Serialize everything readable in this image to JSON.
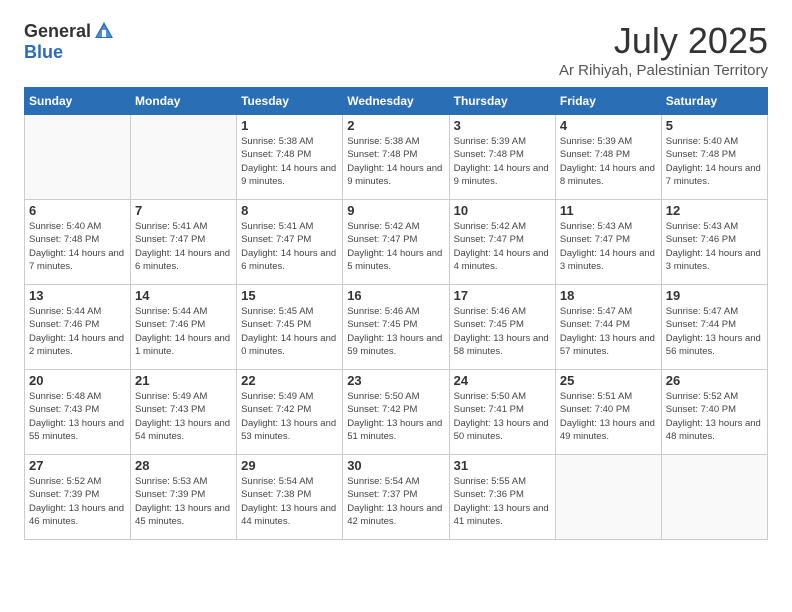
{
  "header": {
    "logo_general": "General",
    "logo_blue": "Blue",
    "title": "July 2025",
    "subtitle": "Ar Rihiyah, Palestinian Territory"
  },
  "weekdays": [
    "Sunday",
    "Monday",
    "Tuesday",
    "Wednesday",
    "Thursday",
    "Friday",
    "Saturday"
  ],
  "weeks": [
    [
      {
        "day": "",
        "info": ""
      },
      {
        "day": "",
        "info": ""
      },
      {
        "day": "1",
        "info": "Sunrise: 5:38 AM\nSunset: 7:48 PM\nDaylight: 14 hours and 9 minutes."
      },
      {
        "day": "2",
        "info": "Sunrise: 5:38 AM\nSunset: 7:48 PM\nDaylight: 14 hours and 9 minutes."
      },
      {
        "day": "3",
        "info": "Sunrise: 5:39 AM\nSunset: 7:48 PM\nDaylight: 14 hours and 9 minutes."
      },
      {
        "day": "4",
        "info": "Sunrise: 5:39 AM\nSunset: 7:48 PM\nDaylight: 14 hours and 8 minutes."
      },
      {
        "day": "5",
        "info": "Sunrise: 5:40 AM\nSunset: 7:48 PM\nDaylight: 14 hours and 7 minutes."
      }
    ],
    [
      {
        "day": "6",
        "info": "Sunrise: 5:40 AM\nSunset: 7:48 PM\nDaylight: 14 hours and 7 minutes."
      },
      {
        "day": "7",
        "info": "Sunrise: 5:41 AM\nSunset: 7:47 PM\nDaylight: 14 hours and 6 minutes."
      },
      {
        "day": "8",
        "info": "Sunrise: 5:41 AM\nSunset: 7:47 PM\nDaylight: 14 hours and 6 minutes."
      },
      {
        "day": "9",
        "info": "Sunrise: 5:42 AM\nSunset: 7:47 PM\nDaylight: 14 hours and 5 minutes."
      },
      {
        "day": "10",
        "info": "Sunrise: 5:42 AM\nSunset: 7:47 PM\nDaylight: 14 hours and 4 minutes."
      },
      {
        "day": "11",
        "info": "Sunrise: 5:43 AM\nSunset: 7:47 PM\nDaylight: 14 hours and 3 minutes."
      },
      {
        "day": "12",
        "info": "Sunrise: 5:43 AM\nSunset: 7:46 PM\nDaylight: 14 hours and 3 minutes."
      }
    ],
    [
      {
        "day": "13",
        "info": "Sunrise: 5:44 AM\nSunset: 7:46 PM\nDaylight: 14 hours and 2 minutes."
      },
      {
        "day": "14",
        "info": "Sunrise: 5:44 AM\nSunset: 7:46 PM\nDaylight: 14 hours and 1 minute."
      },
      {
        "day": "15",
        "info": "Sunrise: 5:45 AM\nSunset: 7:45 PM\nDaylight: 14 hours and 0 minutes."
      },
      {
        "day": "16",
        "info": "Sunrise: 5:46 AM\nSunset: 7:45 PM\nDaylight: 13 hours and 59 minutes."
      },
      {
        "day": "17",
        "info": "Sunrise: 5:46 AM\nSunset: 7:45 PM\nDaylight: 13 hours and 58 minutes."
      },
      {
        "day": "18",
        "info": "Sunrise: 5:47 AM\nSunset: 7:44 PM\nDaylight: 13 hours and 57 minutes."
      },
      {
        "day": "19",
        "info": "Sunrise: 5:47 AM\nSunset: 7:44 PM\nDaylight: 13 hours and 56 minutes."
      }
    ],
    [
      {
        "day": "20",
        "info": "Sunrise: 5:48 AM\nSunset: 7:43 PM\nDaylight: 13 hours and 55 minutes."
      },
      {
        "day": "21",
        "info": "Sunrise: 5:49 AM\nSunset: 7:43 PM\nDaylight: 13 hours and 54 minutes."
      },
      {
        "day": "22",
        "info": "Sunrise: 5:49 AM\nSunset: 7:42 PM\nDaylight: 13 hours and 53 minutes."
      },
      {
        "day": "23",
        "info": "Sunrise: 5:50 AM\nSunset: 7:42 PM\nDaylight: 13 hours and 51 minutes."
      },
      {
        "day": "24",
        "info": "Sunrise: 5:50 AM\nSunset: 7:41 PM\nDaylight: 13 hours and 50 minutes."
      },
      {
        "day": "25",
        "info": "Sunrise: 5:51 AM\nSunset: 7:40 PM\nDaylight: 13 hours and 49 minutes."
      },
      {
        "day": "26",
        "info": "Sunrise: 5:52 AM\nSunset: 7:40 PM\nDaylight: 13 hours and 48 minutes."
      }
    ],
    [
      {
        "day": "27",
        "info": "Sunrise: 5:52 AM\nSunset: 7:39 PM\nDaylight: 13 hours and 46 minutes."
      },
      {
        "day": "28",
        "info": "Sunrise: 5:53 AM\nSunset: 7:39 PM\nDaylight: 13 hours and 45 minutes."
      },
      {
        "day": "29",
        "info": "Sunrise: 5:54 AM\nSunset: 7:38 PM\nDaylight: 13 hours and 44 minutes."
      },
      {
        "day": "30",
        "info": "Sunrise: 5:54 AM\nSunset: 7:37 PM\nDaylight: 13 hours and 42 minutes."
      },
      {
        "day": "31",
        "info": "Sunrise: 5:55 AM\nSunset: 7:36 PM\nDaylight: 13 hours and 41 minutes."
      },
      {
        "day": "",
        "info": ""
      },
      {
        "day": "",
        "info": ""
      }
    ]
  ]
}
